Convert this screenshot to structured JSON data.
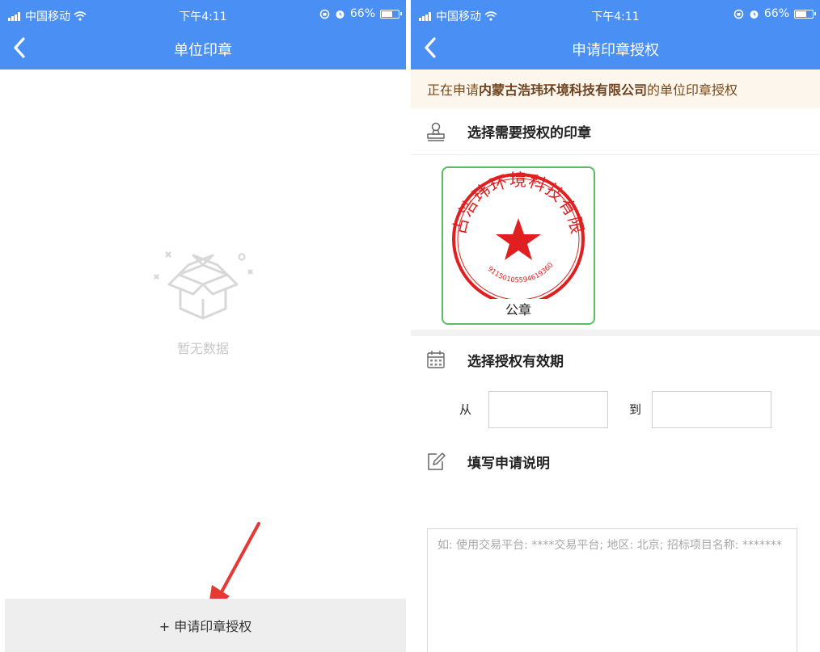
{
  "status": {
    "carrier": "中国移动",
    "time": "下午4:11",
    "battery": "66%",
    "battery_level": 0.66
  },
  "left": {
    "title": "单位印章",
    "empty_text": "暂无数据",
    "apply_button": "+ 申请印章授权"
  },
  "right": {
    "title": "申请印章授权",
    "notice_prefix": "正在申请",
    "notice_company": "内蒙古浩玮环境科技有限公司",
    "notice_suffix": "的单位印章授权",
    "section_seal": "选择需要授权的印章",
    "seal": {
      "company": "内蒙古浩玮环境科技有限公司",
      "code": "91150105594619360",
      "name": "公章"
    },
    "section_period": "选择授权有效期",
    "from_label": "从",
    "to_label": "到",
    "from_value": "",
    "to_value": "",
    "section_desc": "填写申请说明",
    "desc_placeholder": "如: 使用交易平台: ****交易平台; 地区: 北京; 招标项目名称: *******"
  },
  "colors": {
    "header": "#4a8ff3",
    "seal_red": "#e02020",
    "seal_border": "#5dbb63",
    "notice_bg": "#fdf6ec",
    "arrow": "#e53935"
  },
  "icons": [
    "back-icon",
    "signal-icon",
    "wifi-icon",
    "alarm-icon",
    "battery-icon",
    "empty-box-icon",
    "stamp-icon",
    "calendar-icon",
    "edit-icon",
    "arrow-annotation"
  ]
}
